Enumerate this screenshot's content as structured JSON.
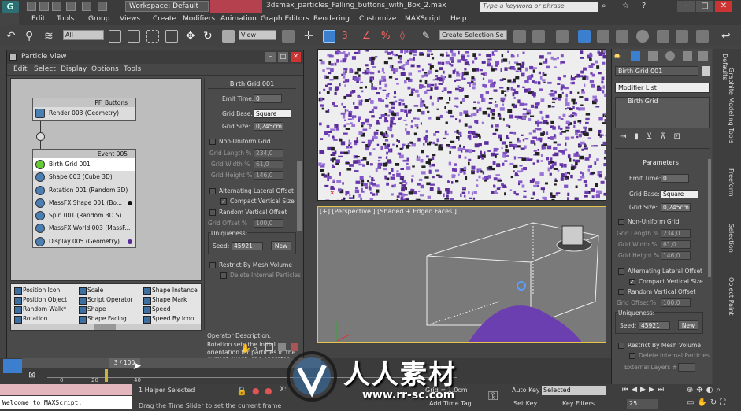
{
  "titlebar": {
    "workspace": "Workspace: Default",
    "file_title": "3dsmax_particles_Falling_buttons_with_Box_2.max",
    "search_placeholder": "Type a keyword or phrase"
  },
  "menu": [
    "Edit",
    "Tools",
    "Group",
    "Views",
    "Create",
    "Modifiers",
    "Animation",
    "Graph Editors",
    "Rendering",
    "Customize",
    "MAXScript",
    "Help"
  ],
  "toolbar": {
    "filter": "All",
    "ref_coord": "View",
    "selection_set": "Create Selection Se"
  },
  "particle_view": {
    "title": "Particle View",
    "menu": [
      "Edit",
      "Select",
      "Display",
      "Options",
      "Tools"
    ],
    "pf_node": {
      "title": "PF_Buttons",
      "rows": [
        "Render 003 (Geometry)"
      ]
    },
    "event_node": {
      "title": "Event 005",
      "rows": [
        "Birth Grid 001",
        "Shape 003 (Cube 3D)",
        "Rotation 001 (Random 3D)",
        "MassFX Shape 001 (Bo...",
        "Spin 001 (Random 3D S)",
        "MassFX World 003 (MassF...",
        "Display 005 (Geometry)"
      ]
    },
    "depot": [
      [
        "Position Icon",
        "Scale",
        "Shape Instance"
      ],
      [
        "Position Object",
        "Script Operator",
        "Shape Mark"
      ],
      [
        "Random Walk*",
        "Shape",
        "Speed"
      ],
      [
        "Rotation",
        "Shape Facing",
        "Speed By Icon"
      ]
    ],
    "props": {
      "rollout": "Birth Grid 001",
      "emit_time_label": "Emit Time:",
      "emit_time": "0",
      "grid_base_label": "Grid Base:",
      "grid_base": "Square",
      "grid_size_label": "Grid Size:",
      "grid_size": "0,245cm",
      "non_uniform": "Non-Uniform Grid",
      "grid_length_label": "Grid Length %",
      "grid_length": "234,0",
      "grid_width_label": "Grid Width %",
      "grid_width": "61,0",
      "grid_height_label": "Grid Height %",
      "grid_height": "146,0",
      "alt_lateral": "Alternating Lateral Offset",
      "compact_vertical": "Compact Vertical Size",
      "random_vertical": "Random Vertical Offset",
      "grid_offset_label": "Grid Offset %",
      "grid_offset": "100,0",
      "uniqueness": "Uniqueness:",
      "seed_label": "Seed:",
      "seed": "45921",
      "new_btn": "New",
      "restrict": "Restrict By Mesh Volume",
      "delete_internal": "Delete Internal Particles"
    },
    "description_title": "Operator Description:",
    "description": "Rotation sets the initial orientation for particles in the current event. The operator can control particle orientation constantly if 'Speed Space"
  },
  "viewport": {
    "label": "[+] [Perspective ] [Shaded + Edged Faces ]"
  },
  "command_panel": {
    "name_field": "Birth Grid 001",
    "modifier_list": "Modifier List",
    "stack_item": "Birth Grid",
    "rollout": "Parameters",
    "emit_time_label": "Emit Time:",
    "emit_time": "0",
    "grid_base_label": "Grid Base:",
    "grid_base": "Square",
    "grid_size_label": "Grid Size:",
    "grid_size": "0,245cm",
    "non_uniform": "Non-Uniform Grid",
    "grid_length_label": "Grid Length %",
    "grid_length": "234,0",
    "grid_width_label": "Grid Width %",
    "grid_width": "61,0",
    "grid_height_label": "Grid Height %",
    "grid_height": "146,0",
    "alt_lateral": "Alternating Lateral Offset",
    "compact_vertical": "Compact Vertical Size",
    "random_vertical": "Random Vertical Offset",
    "grid_offset_label": "Grid Offset %",
    "grid_offset": "100,0",
    "uniqueness": "Uniqueness:",
    "seed_label": "Seed:",
    "seed": "45921",
    "new_btn": "New",
    "restrict": "Restrict By Mesh Volume",
    "delete_internal": "Delete Internal Particles",
    "external_layers": "External Layers #"
  },
  "side_tabs": [
    "Defaults",
    "Graphite Modeling Tools",
    "Freeform",
    "Selection",
    "Object Paint"
  ],
  "timeline": {
    "frame_display": "3 / 100",
    "ticks": [
      "0",
      "20",
      "40"
    ]
  },
  "status": {
    "maxscript": "Welcome to MAXScript.",
    "selection": "1 Helper Selected",
    "prompt": "Drag the Time Slider to set the current frame",
    "grid": "Grid = 1,0cm",
    "add_time_tag": "Add Time Tag",
    "auto_key": "Auto Key",
    "set_key": "Set Key",
    "selected": "Selected",
    "key_filters": "Key Filters...",
    "frame": "25"
  },
  "watermark": {
    "title": "人人素材",
    "url": "www.rr-sc.com"
  },
  "colors": {
    "particle": "#7a4bb8",
    "viewport_border": "#e4c44a",
    "accent_blue": "#3d7fcf"
  }
}
